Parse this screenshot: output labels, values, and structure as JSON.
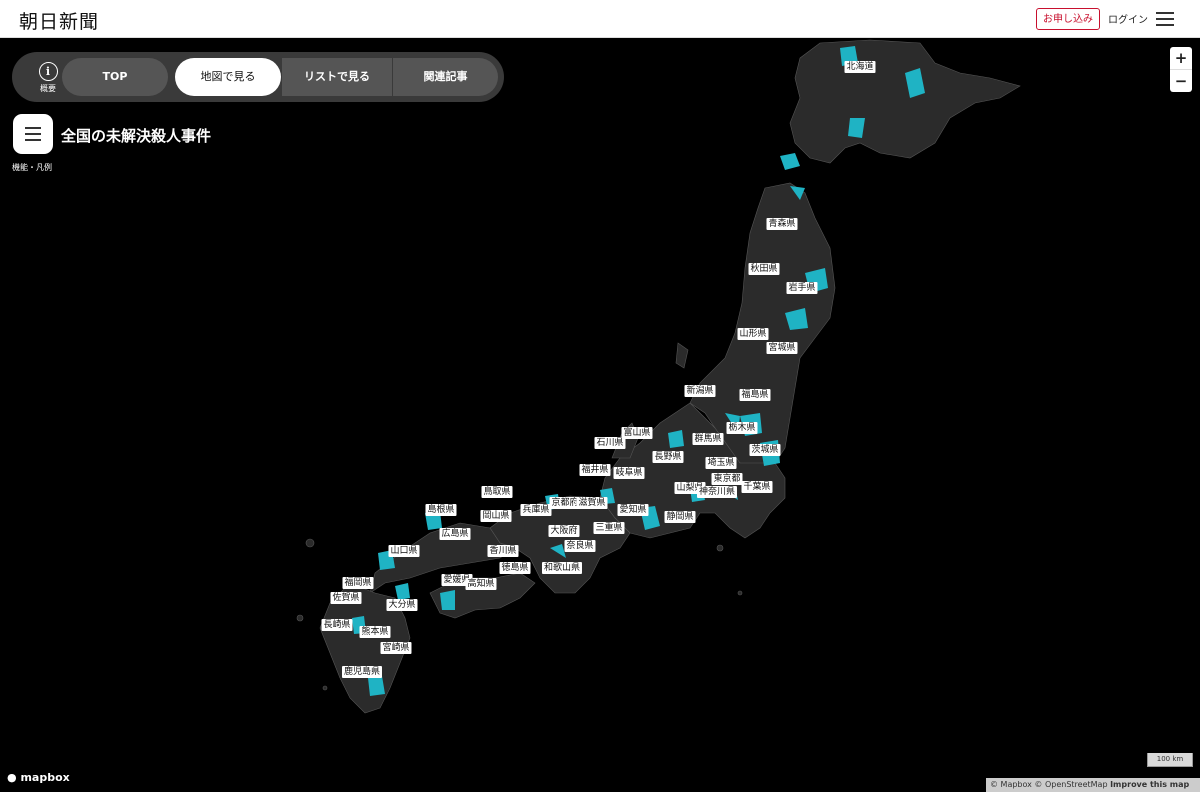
{
  "header": {
    "logo": "朝日新聞",
    "subscribe_label": "お申し込み",
    "login_label": "ログイン"
  },
  "nav": {
    "info_label": "概要",
    "tabs": [
      {
        "label": "TOP"
      },
      {
        "label": "地図で見る"
      },
      {
        "label": "リストで見る"
      },
      {
        "label": "関連記事"
      }
    ]
  },
  "title": "全国の未解決殺人事件",
  "legend_label": "機能・凡例",
  "zoom": {
    "in": "+",
    "out": "−"
  },
  "map": {
    "highlight_color": "#1fb3c4",
    "land_color": "#2b2b2b",
    "prefectures": [
      "北海道",
      "青森県",
      "秋田県",
      "岩手県",
      "山形県",
      "宮城県",
      "新潟県",
      "福島県",
      "富山県",
      "石川県",
      "群馬県",
      "栃木県",
      "茨城県",
      "長野県",
      "埼玉県",
      "福井県",
      "岐阜県",
      "東京都",
      "山梨県",
      "神奈川県",
      "千葉県",
      "鳥取県",
      "兵庫県",
      "京都府",
      "滋賀県",
      "愛知県",
      "静岡県",
      "島根県",
      "岡山県",
      "大阪府",
      "三重県",
      "広島県",
      "奈良県",
      "山口県",
      "香川県",
      "愛媛県",
      "徳島県",
      "和歌山県",
      "高知県",
      "福岡県",
      "佐賀県",
      "大分県",
      "長崎県",
      "熊本県",
      "宮崎県",
      "鹿児島県"
    ]
  },
  "footer": {
    "mapbox": "mapbox",
    "scale": "100 km",
    "attribution": "© Mapbox © OpenStreetMap",
    "improve": "Improve this map"
  }
}
